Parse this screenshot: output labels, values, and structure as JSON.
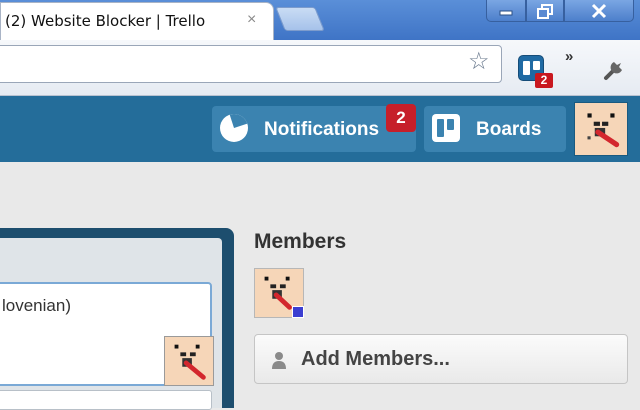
{
  "browser": {
    "tab_title": "(2) Website Blocker | Trello",
    "tab_close": "×",
    "star_glyph": "☆",
    "overflow_glyph": "»",
    "extension_badge": "2"
  },
  "header": {
    "notifications_label": "Notifications",
    "notifications_count": "2",
    "boards_label": "Boards",
    "color": "#246d9a",
    "button_color": "#3b83b0"
  },
  "card": {
    "text": "lovenian)"
  },
  "members": {
    "title": "Members",
    "add_button_label": "Add Members..."
  },
  "icons": {
    "tab_close": "close-icon",
    "bookmark": "star-icon",
    "trello_extension": "trello-icon",
    "settings": "wrench-icon",
    "notifications": "notifications-icon",
    "boards": "boards-icon",
    "add_member": "person-icon"
  }
}
